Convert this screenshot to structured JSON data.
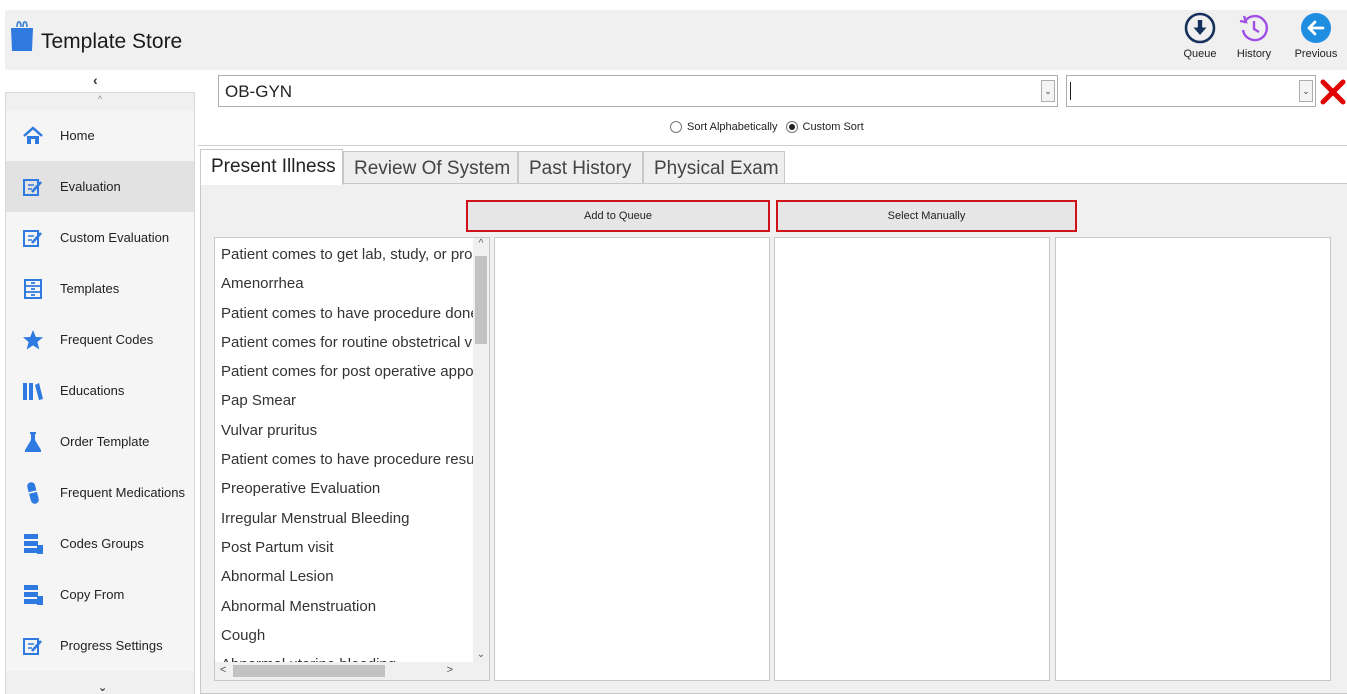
{
  "app": {
    "title": "Template Store",
    "logo_icon": "shopping-bag-icon"
  },
  "toolbar": {
    "queue_label": "Queue",
    "history_label": "History",
    "previous_label": "Previous"
  },
  "colors": {
    "queue": "#14305c",
    "history": "#a050e6",
    "previous": "#1f8de0",
    "accent_icon": "#3a7fd5",
    "highlight_border": "#d0121b",
    "clear_x": "#e00000"
  },
  "sidebar": {
    "items": [
      {
        "label": "Home",
        "icon": "home-icon"
      },
      {
        "label": "Evaluation",
        "icon": "edit-form-icon",
        "active": true
      },
      {
        "label": "Custom Evaluation",
        "icon": "edit-form-icon"
      },
      {
        "label": "Templates",
        "icon": "cabinet-icon"
      },
      {
        "label": "Frequent Codes",
        "icon": "star-icon"
      },
      {
        "label": "Educations",
        "icon": "books-icon"
      },
      {
        "label": "Order Template",
        "icon": "flask-icon"
      },
      {
        "label": "Frequent Medications",
        "icon": "pill-icon"
      },
      {
        "label": "Codes Groups",
        "icon": "stack-icon"
      },
      {
        "label": "Copy From",
        "icon": "stack-icon"
      },
      {
        "label": "Progress Settings",
        "icon": "edit-form-icon"
      }
    ]
  },
  "specialty_select": {
    "value": "OB-GYN"
  },
  "secondary_select": {
    "value": ""
  },
  "sort": {
    "alphabetical_label": "Sort Alphabetically",
    "custom_label": "Custom Sort",
    "selected": "custom"
  },
  "tabs": [
    {
      "label": "Present Illness",
      "active": true
    },
    {
      "label": "Review Of System"
    },
    {
      "label": "Past History"
    },
    {
      "label": "Physical Exam"
    }
  ],
  "actions": {
    "add_to_queue": "Add to Queue",
    "select_manually": "Select Manually"
  },
  "complaints": [
    "Patient comes to get lab, study, or procedure result",
    "Amenorrhea",
    "Patient comes to have procedure done",
    "Patient comes for routine obstetrical visit",
    "Patient comes for post operative appointment",
    "Pap Smear",
    "Vulvar pruritus",
    "Patient comes to have procedure result",
    "Preoperative Evaluation",
    "Irregular Menstrual Bleeding",
    "Post Partum visit",
    "Abnormal Lesion",
    "Abnormal Menstruation",
    "Cough",
    "Abnormal uterine bleeding"
  ]
}
